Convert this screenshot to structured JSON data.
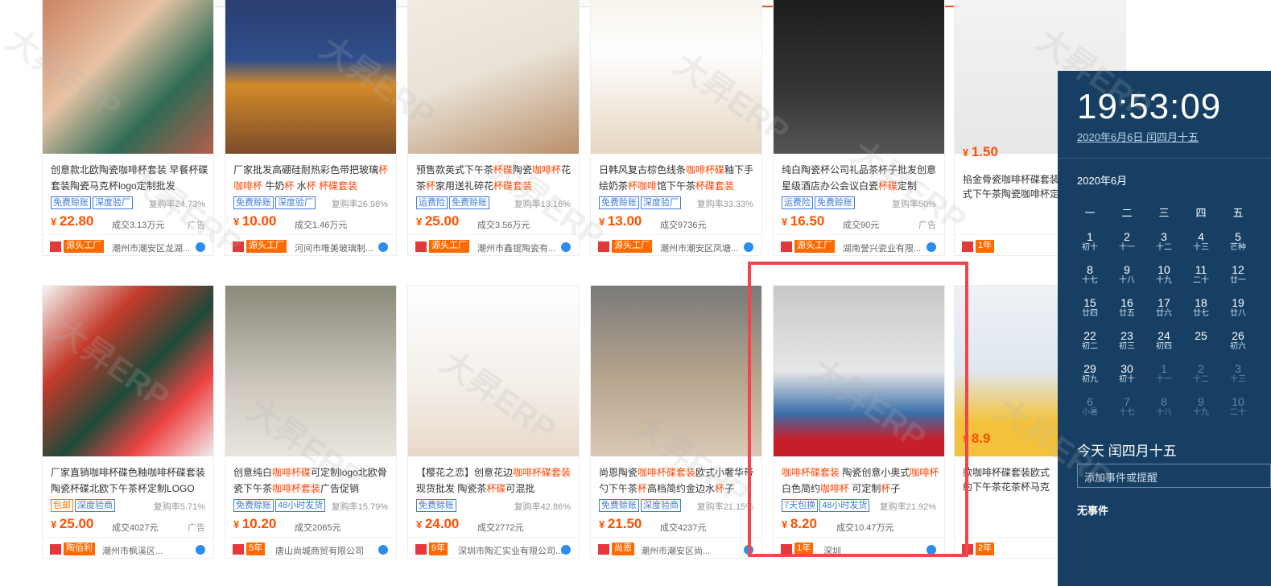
{
  "colors": {
    "accent": "#ff5000",
    "tag_blue": "#3c7cd6",
    "highlight_box": "#f0464c",
    "clock_bg": "#163f63"
  },
  "products": [
    {
      "id": "p1",
      "title_html": "创意款北欧陶瓷咖啡杯套装 早餐杯碟套装陶瓷马克杯logo定制批发",
      "tags": [
        "免费赊账",
        "深度验厂"
      ],
      "rate": "复购率24.73%",
      "price": "22.80",
      "deal": "成交3.13万元",
      "ad": "广告",
      "badge": "源头工厂",
      "shop": "潮州市潮安区龙湖..."
    },
    {
      "id": "p2",
      "title_html": "厂家批发高硼硅耐热彩色带把玻璃<span class='hl'>杯</span> <span class='hl'>咖啡杯</span> 牛奶<span class='hl'>杯</span> 水<span class='hl'>杯</span> <span class='hl'>杯碟套装</span>",
      "tags": [
        "免费赊账",
        "深度验厂"
      ],
      "rate": "复购率26.98%",
      "price": "10.00",
      "deal": "成交1.46万元",
      "ad": "",
      "badge": "源头工厂",
      "shop": "河间市唯美玻璃制..."
    },
    {
      "id": "p3",
      "title_html": "预售款英式下午茶<span class='hl'>杯碟</span>陶瓷<span class='hl'>咖啡杯</span>花茶<span class='hl'>杯</span>家用送礼碎花<span class='hl'>杯碟套装</span>",
      "tags": [
        "运费险",
        "免费赊账"
      ],
      "rate": "复购率13.16%",
      "price": "25.00",
      "deal": "成交3.56万元",
      "ad": "",
      "badge": "源头工厂",
      "shop": "潮州市鑫锟陶瓷有..."
    },
    {
      "id": "p4",
      "title_html": "日韩风复古棕色线条<span class='hl'>咖啡杯碟</span>釉下手绘奶茶<span class='hl'>杯咖啡</span>馆下午茶<span class='hl'>杯碟套装</span>",
      "tags": [
        "免费赊账",
        "深度验厂"
      ],
      "rate": "复购率33.33%",
      "price": "13.00",
      "deal": "成交9736元",
      "ad": "",
      "badge": "源头工厂",
      "shop": "潮州市潮安区凤塘..."
    },
    {
      "id": "p5",
      "title_html": "纯白陶瓷杯公司礼品茶杯子批发创意星级酒店办公会议白瓷<span class='hl'>杯碟</span>定制",
      "tags": [
        "运费险",
        "免费赊账"
      ],
      "rate": "复购率50%",
      "price": "16.50",
      "deal": "成交90元",
      "ad": "广告",
      "badge": "源头工厂",
      "shop": "湖南誉兴瓷业有限..."
    },
    {
      "id": "p6",
      "title_html": "",
      "tags": [],
      "rate": "",
      "price": "1.50",
      "deal": "",
      "ad": "",
      "badge": "",
      "shop": "",
      "extra": [
        "掐金骨瓷咖啡杯碟套装",
        "式下午茶陶瓷咖啡杯定"
      ],
      "years": "1年"
    },
    {
      "id": "p7",
      "title_html": "厂家直销咖啡杯碟色釉咖啡杯碟套装陶瓷杯碟北欧下午茶杯定制LOGO",
      "tags": [
        "包邮",
        "深度验商"
      ],
      "rate": "复购率5.71%",
      "price": "25.00",
      "deal": "成交4027元",
      "ad": "广告",
      "badge": "陶佰利",
      "shop": "潮州市枫溪区..."
    },
    {
      "id": "p8",
      "title_html": "创意纯白<span class='hl'>咖啡杯碟</span>可定制logo北欧骨瓷下午茶<span class='hl'>咖啡杯套装</span>广告促销",
      "tags": [
        "免费赊账",
        "48小时发货"
      ],
      "rate": "复购率15.79%",
      "price": "10.20",
      "deal": "成交2065元",
      "ad": "",
      "badge": "5年",
      "shop": "唐山尚城商贸有限公司"
    },
    {
      "id": "p9",
      "title_html": "【樱花之恋】创意花边<span class='hl'>咖啡杯碟套装</span>现货批发 陶瓷茶<span class='hl'>杯碟</span>可混批",
      "tags": [
        "免费赊账"
      ],
      "rate": "复购率42.86%",
      "price": "24.00",
      "deal": "成交2772元",
      "ad": "",
      "badge": "9年",
      "shop": "深圳市陶汇实业有限公司..."
    },
    {
      "id": "p10",
      "title_html": "尚恩陶瓷<span class='hl'>咖啡杯碟套装</span>欧式小奢华带勺下午茶<span class='hl'>杯</span>高档简约金边水<span class='hl'>杯</span>子",
      "tags": [
        "免费赊账",
        "深度验商"
      ],
      "rate": "复购率21.15%",
      "price": "21.50",
      "deal": "成交4237元",
      "ad": "",
      "badge": "尚恩",
      "shop": "潮州市潮安区尚..."
    },
    {
      "id": "p11",
      "title_html": "<span class='hl'>咖啡杯碟套装</span> 陶瓷创意小奥式<span class='hl'>咖啡杯</span>白色简约<span class='hl'>咖啡杯</span> 可定制<span class='hl'>杯</span>子",
      "tags": [
        "7天包换",
        "48小时发货"
      ],
      "rate": "复购率21.92%",
      "price": "8.20",
      "deal": "成交10.47万元",
      "ad": "",
      "badge": "1年",
      "shop": "深圳"
    },
    {
      "id": "p12",
      "title_html": "",
      "tags": [],
      "rate": "",
      "price": "8.9",
      "deal": "",
      "ad": "",
      "badge": "",
      "shop": "",
      "extra": [
        "款咖啡杯碟套装欧式",
        "约下午茶花茶杯马克"
      ],
      "years": "2年"
    }
  ],
  "clock": {
    "time": "19:53:09",
    "date": "2020年6月6日 闰四月十五",
    "month": "2020年6月",
    "weekdays": [
      "一",
      "二",
      "三",
      "四",
      "五"
    ],
    "rows": [
      [
        [
          "1",
          "初十"
        ],
        [
          "2",
          "十一"
        ],
        [
          "3",
          "十二"
        ],
        [
          "4",
          "十三"
        ],
        [
          "5",
          "芒种"
        ]
      ],
      [
        [
          "8",
          "十七"
        ],
        [
          "9",
          "十八"
        ],
        [
          "10",
          "十九"
        ],
        [
          "11",
          "二十"
        ],
        [
          "12",
          "廿一"
        ]
      ],
      [
        [
          "15",
          "廿四"
        ],
        [
          "16",
          "廿五"
        ],
        [
          "17",
          "廿六"
        ],
        [
          "18",
          "廿七"
        ],
        [
          "19",
          "廿八"
        ]
      ],
      [
        [
          "22",
          "初二"
        ],
        [
          "23",
          "初三"
        ],
        [
          "24",
          "初四"
        ],
        [
          "25",
          ""
        ],
        [
          "26",
          "初六"
        ]
      ],
      [
        [
          "29",
          "初九"
        ],
        [
          "30",
          "初十"
        ],
        [
          "1",
          "十一"
        ],
        [
          "2",
          "十二"
        ],
        [
          "3",
          "十三"
        ]
      ],
      [
        [
          "6",
          "小暑"
        ],
        [
          "7",
          "十七"
        ],
        [
          "8",
          "十八"
        ],
        [
          "9",
          "十九"
        ],
        [
          "10",
          "二十"
        ]
      ]
    ],
    "today_label": "今天 闰四月十五",
    "event_placeholder": "添加事件或提醒",
    "no_event": "无事件"
  },
  "watermark_text": "大昇ERP"
}
